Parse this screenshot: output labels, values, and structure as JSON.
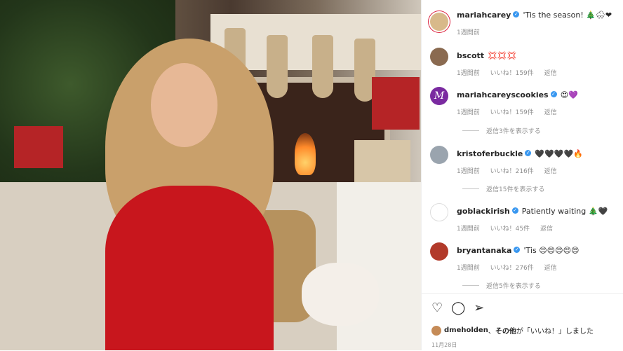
{
  "post": {
    "author": "mariahcarey",
    "caption": "'Tis the season! 🎄🌨❤",
    "time": "1週間前"
  },
  "comments": [
    {
      "user": "bscott",
      "verified": false,
      "text": "💢💢💢",
      "time": "1週間前",
      "likes": "いいね！159件",
      "reply": "返信"
    },
    {
      "user": "mariahcareyscookies",
      "verified": true,
      "text": "😍💜",
      "time": "1週間前",
      "likes": "いいね！159件",
      "reply": "返信",
      "view_replies": "返信3件を表示する"
    },
    {
      "user": "kristoferbuckle",
      "verified": true,
      "text": "🖤🖤🖤🖤🔥",
      "time": "1週間前",
      "likes": "いいね！216件",
      "reply": "返信",
      "view_replies": "返信15件を表示する"
    },
    {
      "user": "goblackirish",
      "verified": true,
      "text": "Patiently waiting 🎄🖤",
      "time": "1週間前",
      "likes": "いいね！45件",
      "reply": "返信"
    },
    {
      "user": "bryantanaka",
      "verified": true,
      "text": "'Tis 😍😍😍😍😍",
      "time": "1週間前",
      "likes": "いいね！276件",
      "reply": "返信",
      "view_replies": "返信5件を表示する"
    }
  ],
  "liked_by": {
    "user": "dmeholden",
    "separator": "、",
    "others": "その他",
    "suffix": "が「いいね！」しました"
  },
  "date": "11月28日",
  "colors": {
    "verified": "#3897f0",
    "link": "#262626",
    "meta": "#8e8e8e"
  }
}
